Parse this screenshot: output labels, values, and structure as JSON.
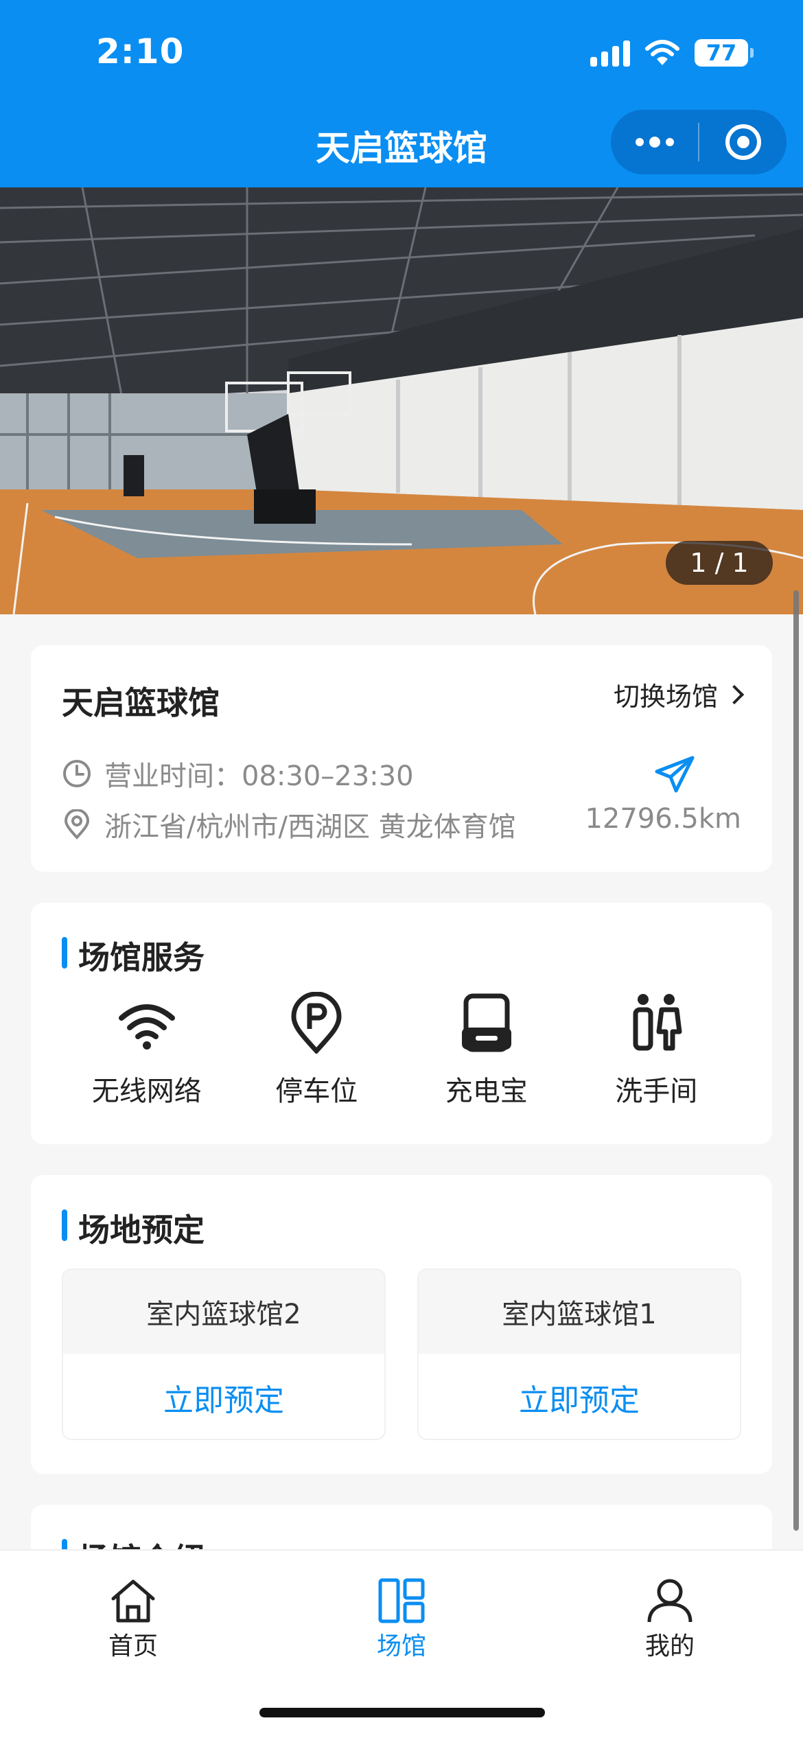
{
  "status_bar": {
    "time": "2:10",
    "battery": "77"
  },
  "nav": {
    "title": "天启篮球馆"
  },
  "hero": {
    "pager": "1 / 1"
  },
  "venue": {
    "name": "天启篮球馆",
    "switch_label": "切换场馆",
    "hours": "营业时间：08:30–23:30",
    "address": "浙江省/杭州市/西湖区 黄龙体育馆",
    "distance": "12796.5km"
  },
  "services": {
    "title": "场馆服务",
    "items": [
      {
        "label": "无线网络",
        "icon": "wifi-icon"
      },
      {
        "label": "停车位",
        "icon": "parking-icon"
      },
      {
        "label": "充电宝",
        "icon": "power-bank-icon"
      },
      {
        "label": "洗手间",
        "icon": "restroom-icon"
      }
    ]
  },
  "booking": {
    "title": "场地预定",
    "courts": [
      {
        "name": "室内篮球馆2",
        "action": "立即预定"
      },
      {
        "name": "室内篮球馆1",
        "action": "立即预定"
      }
    ]
  },
  "intro": {
    "title": "场馆介绍"
  },
  "tabbar": {
    "items": [
      {
        "label": "首页",
        "icon": "home-icon"
      },
      {
        "label": "场馆",
        "icon": "venue-grid-icon",
        "active": true
      },
      {
        "label": "我的",
        "icon": "profile-icon"
      }
    ]
  },
  "colors": {
    "primary": "#0a8ef2",
    "background": "#f6f6f6"
  }
}
